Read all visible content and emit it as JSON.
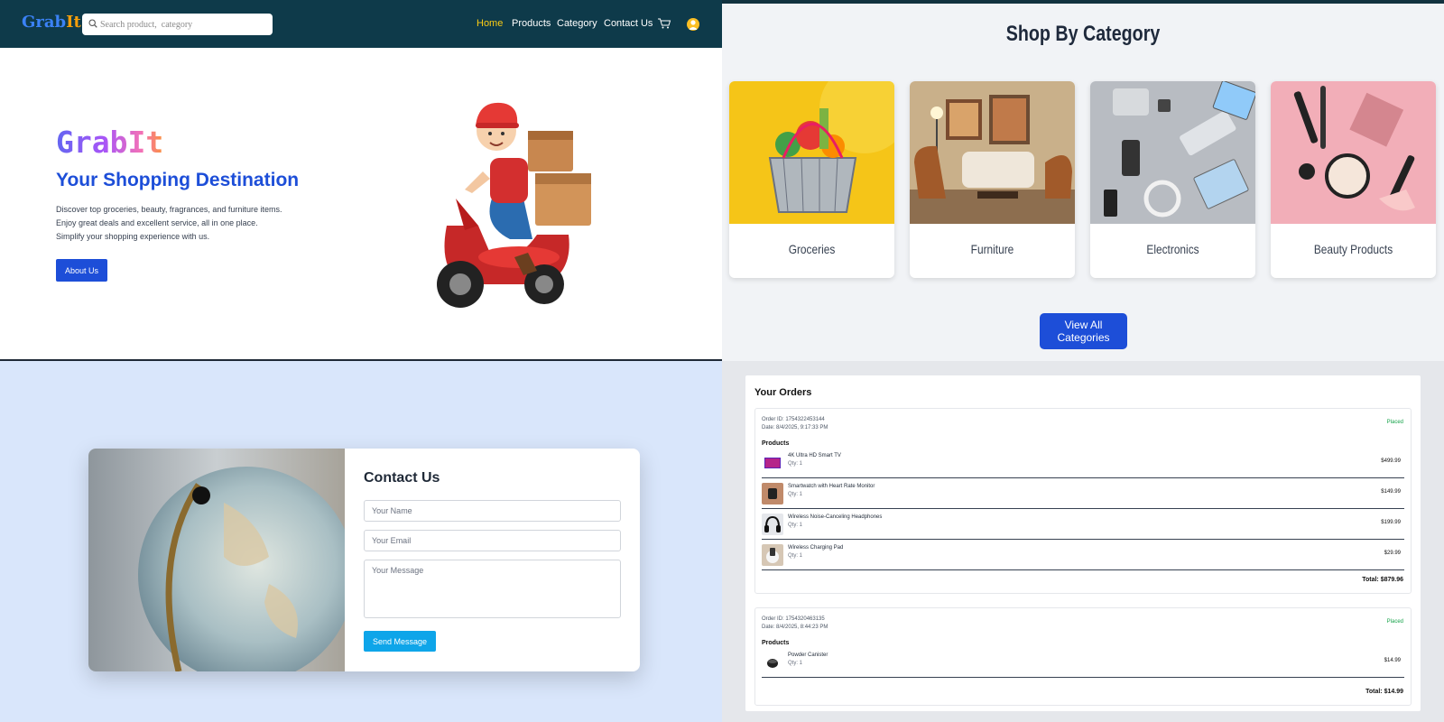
{
  "navbar": {
    "logo_part1": "Grab",
    "logo_part2": "It",
    "search_placeholder": "Search product,  category",
    "links": [
      "Home",
      "Products",
      "Category",
      "Contact Us"
    ],
    "active_link": "Home",
    "cart_icon": "cart-icon",
    "user_icon": "user-avatar-icon"
  },
  "hero": {
    "brand": "GrabIt",
    "heading": "Your Shopping Destination",
    "lines": [
      "Discover top groceries, beauty, fragrances, and furniture items.",
      "Enjoy great deals and excellent service, all in one place.",
      "Simplify your shopping experience with us."
    ],
    "button": "About Us",
    "colors": {
      "heading": "#1d4ed8",
      "button": "#1d4ed8"
    }
  },
  "categories": {
    "title": "Shop By Category",
    "items": [
      "Groceries",
      "Furniture",
      "Electronics",
      "Beauty Products"
    ],
    "button": "View All Categories"
  },
  "contact": {
    "title": "Contact Us",
    "name_placeholder": "Your Name",
    "email_placeholder": "Your Email",
    "message_placeholder": "Your Message",
    "button": "Send Message"
  },
  "orders": {
    "title": "Your Orders",
    "products_label": "Products",
    "list": [
      {
        "id": "Order ID: 1754322453144",
        "date": "Date: 8/4/2025, 9:17:33 PM",
        "status": "Placed",
        "items": [
          {
            "name": "4K Ultra HD Smart TV",
            "qty": "Qty: 1",
            "price": "$499.99"
          },
          {
            "name": "Smartwatch with Heart Rate Monitor",
            "qty": "Qty: 1",
            "price": "$149.99"
          },
          {
            "name": "Wireless Noise-Canceling Headphones",
            "qty": "Qty: 1",
            "price": "$199.99"
          },
          {
            "name": "Wireless Charging Pad",
            "qty": "Qty: 1",
            "price": "$29.99"
          }
        ],
        "total": "Total: $879.96"
      },
      {
        "id": "Order ID: 1754320463135",
        "date": "Date: 8/4/2025, 8:44:23 PM",
        "status": "Placed",
        "items": [
          {
            "name": "Powder Canister",
            "qty": "Qty: 1",
            "price": "$14.99"
          }
        ],
        "total": "Total: $14.99"
      }
    ]
  }
}
